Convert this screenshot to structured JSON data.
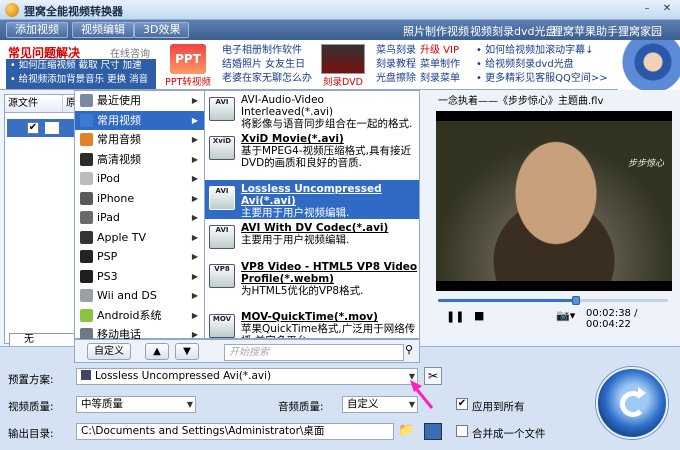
{
  "window": {
    "title": "狸窝全能视频转换器"
  },
  "navbar": {
    "buttons": [
      "添加视频",
      "视频编辑",
      "3D效果"
    ],
    "links": [
      "照片制作视频",
      "视频刻录dvd光盘",
      "狸窝苹果助手",
      "狸窝家园"
    ]
  },
  "ads": {
    "faq_title": "常见问题解决",
    "faq_online": "在线咨询",
    "faq_lines": [
      "• 如何压缩视频 截取 尺寸 加速",
      "• 给视频添加背景音乐 更换 消音"
    ],
    "ppt_img_text": "PPT",
    "ppt_caption": "PPT转视频",
    "col1": [
      "电子相册制作软件",
      "结婚照片 女友生日",
      "老婆在家无聊怎么办"
    ],
    "dvd_caption": "刻录DVD",
    "col2_a": [
      "菜鸟刻录",
      "刻录教程",
      "光盘擦除"
    ],
    "col2_b": [
      "升级 VIP",
      "菜单制作",
      "刻录菜单"
    ],
    "col3": [
      "• 如何给视频加滚动字幕↓",
      "• 给视频刻录dvd光盘",
      "• 更多精彩见客服QQ空间>>"
    ]
  },
  "list": {
    "col_source": "源文件",
    "col_2": "原",
    "footer": "无"
  },
  "categories": [
    {
      "label": "最近使用",
      "color": "#7a8aa0"
    },
    {
      "label": "常用视频",
      "color": "#3b7bd8",
      "selected": true
    },
    {
      "label": "常用音频",
      "color": "#e0812b"
    },
    {
      "label": "高清视频",
      "color": "#2c2c2c"
    },
    {
      "label": "iPod",
      "color": "#bcbcbc"
    },
    {
      "label": "iPhone",
      "color": "#5a5a5a"
    },
    {
      "label": "iPad",
      "color": "#6a6a6a"
    },
    {
      "label": "Apple TV",
      "color": "#333333"
    },
    {
      "label": "PSP",
      "color": "#222222"
    },
    {
      "label": "PS3",
      "color": "#1e1e1e"
    },
    {
      "label": "Wii and DS",
      "color": "#9aa0a8"
    },
    {
      "label": "Android系统",
      "color": "#8ac43f"
    },
    {
      "label": "移动电话",
      "color": "#6f7782"
    }
  ],
  "formats": [
    {
      "icon": "AVI",
      "name": "",
      "desc_top": "AVI-Audio-Video Interleaved(*.avi)",
      "desc": "将影像与语音同步组合在一起的格式."
    },
    {
      "icon": "XviD",
      "name": "XviD Movie(*.avi)",
      "desc": "基于MPEG4-视频压缩格式,具有接近DVD的画质和良好的音质."
    },
    {
      "icon": "AVI",
      "name": "Lossless Uncompressed Avi(*.avi)",
      "desc": "主要用于用户视频编辑.",
      "selected": true
    },
    {
      "icon": "AVI",
      "name": "AVI With DV Codec(*.avi)",
      "desc": "主要用于用户视频编辑."
    },
    {
      "icon": "VP8",
      "name": "VP8 Video - HTML5 VP8 Video Profile(*.webm)",
      "desc": "为HTML5优化的VP8格式."
    },
    {
      "icon": "MOV",
      "name": "MOV-QuickTime(*.mov)",
      "desc": "苹果QuickTime格式,广泛用于网络传播,兼容多平台."
    }
  ],
  "popup_footer": {
    "custom_label": "自定义",
    "search_placeholder": "开始搜索"
  },
  "preview": {
    "title": "一念执着——《步步惊心》主题曲.flv",
    "watermark": "步步惊心",
    "progress": 0.6,
    "volume": 0.7,
    "time_current": "00:02:38",
    "time_total": "00:04:22"
  },
  "bottom": {
    "preset_label": "预置方案:",
    "preset_value": "Lossless Uncompressed Avi(*.avi)",
    "video_quality_label": "视频质量:",
    "video_quality_value": "中等质量",
    "audio_quality_label": "音频质量:",
    "audio_quality_value": "自定义",
    "apply_all_label": "应用到所有",
    "output_label": "输出目录:",
    "output_path": "C:\\Documents and Settings\\Administrator\\桌面",
    "merge_label": "合并成一个文件"
  },
  "colors": {
    "accent": "#316ac5",
    "navbar": "#4a6ca1",
    "arrow": "#ff1fbf"
  }
}
